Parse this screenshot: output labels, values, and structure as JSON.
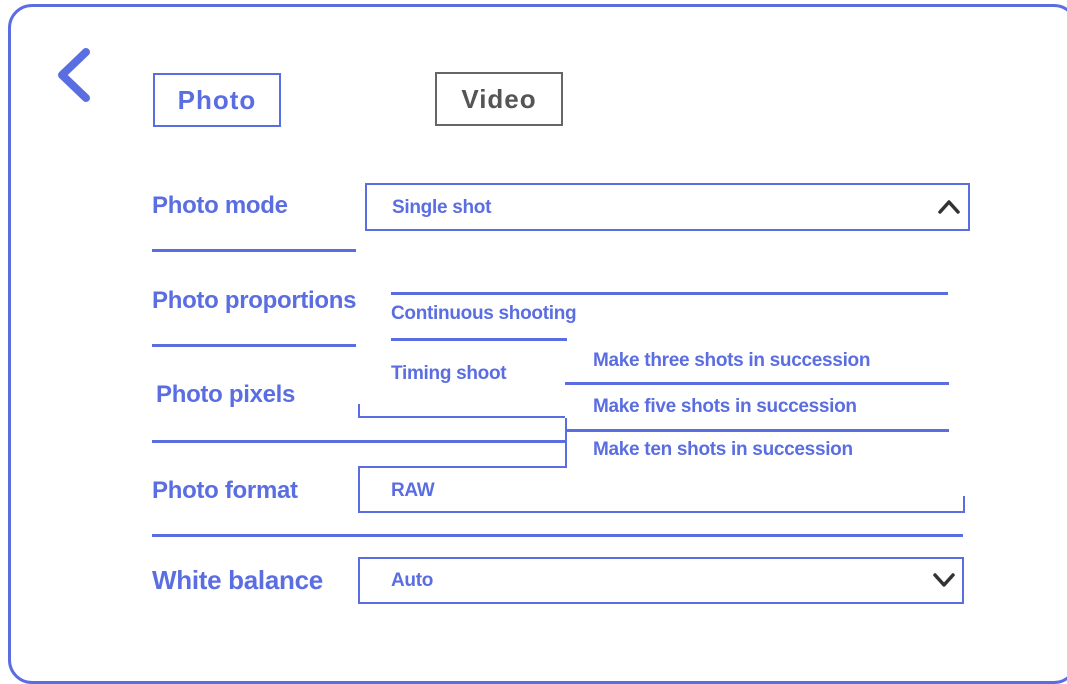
{
  "nav": {
    "back_icon": "chevron-left-icon"
  },
  "tabs": [
    {
      "label": "Photo",
      "active": true
    },
    {
      "label": "Video",
      "active": false
    }
  ],
  "settings": {
    "photo_mode": {
      "label": "Photo mode",
      "value": "Single shot",
      "icon": "chevron-up-icon"
    },
    "photo_proportions": {
      "label": "Photo proportions"
    },
    "photo_pixels": {
      "label": "Photo pixels"
    },
    "photo_format": {
      "label": "Photo format",
      "value": "RAW"
    },
    "white_balance": {
      "label": "White balance",
      "value": "Auto",
      "icon": "chevron-down-icon"
    }
  },
  "mode_menu": {
    "items": [
      "Continuous shooting",
      "Timing shoot"
    ],
    "submenu": [
      "Make three shots in succession",
      "Make five shots in succession",
      "Make ten shots in succession"
    ]
  },
  "colors": {
    "accent": "#5b6ee1",
    "inactive": "#666666"
  }
}
